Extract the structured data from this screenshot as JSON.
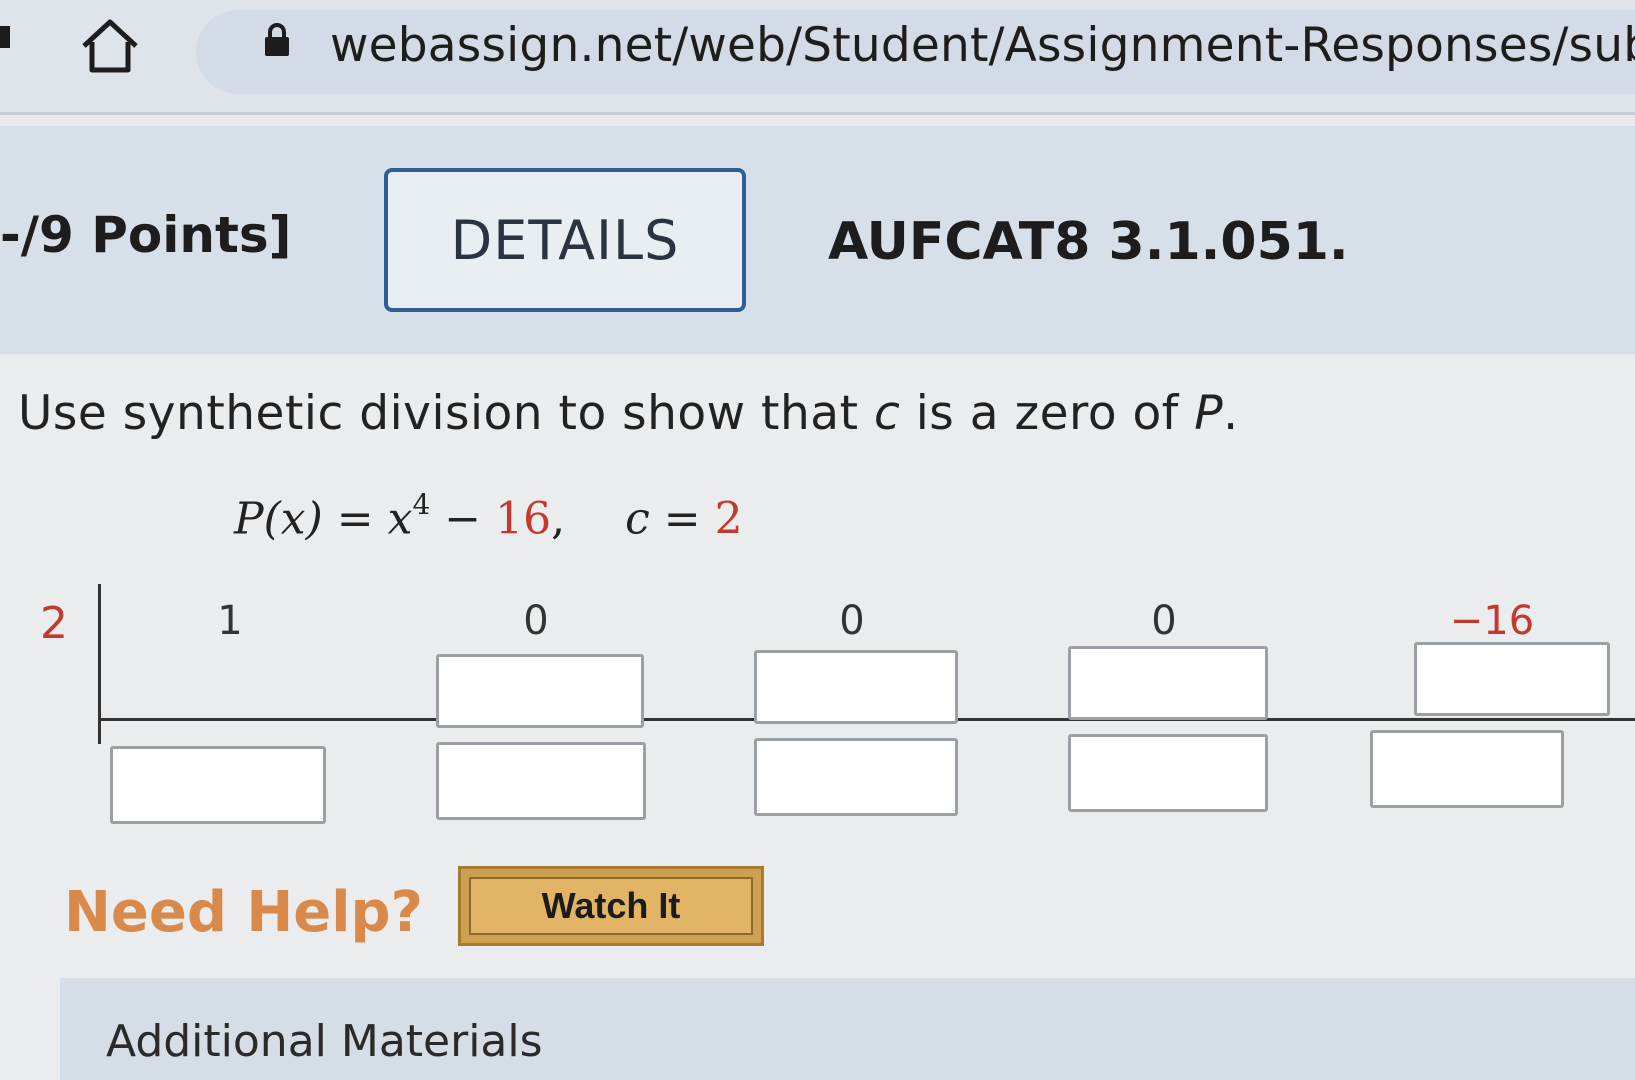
{
  "browser": {
    "url": "webassign.net/web/Student/Assignment-Responses/subm",
    "icons": {
      "home": "home-icon",
      "lock": "lock-icon"
    }
  },
  "question": {
    "points": "-/9 Points]",
    "details_label": "DETAILS",
    "problem_id": "AUFCAT8 3.1.051."
  },
  "problem": {
    "instruction_pre": "Use synthetic division to show that ",
    "instruction_c": "c",
    "instruction_mid": " is a zero of ",
    "instruction_p": "P",
    "instruction_post": ".",
    "equation": {
      "lhs": "P(x)",
      "eq1": " = ",
      "var": "x",
      "exp": "4",
      "minus": " − ",
      "constant": "16",
      "comma": ",",
      "c_var": "c",
      "eq2": " = ",
      "c_value": "2"
    }
  },
  "synthetic_division": {
    "divisor": "2",
    "coefficients": [
      "1",
      "0",
      "0",
      "0",
      "−16"
    ],
    "middle_row_values": [
      "",
      "",
      "",
      ""
    ],
    "bottom_row_values": [
      "",
      "",
      "",
      "",
      ""
    ]
  },
  "help": {
    "label": "Need Help?",
    "watch_button": "Watch It"
  },
  "materials": {
    "label": "Additional Materials"
  },
  "colors": {
    "accent_red": "#c4392f",
    "details_border": "#2f5e96",
    "help_orange": "#d98a4a",
    "watch_gold": "#e1b565"
  }
}
